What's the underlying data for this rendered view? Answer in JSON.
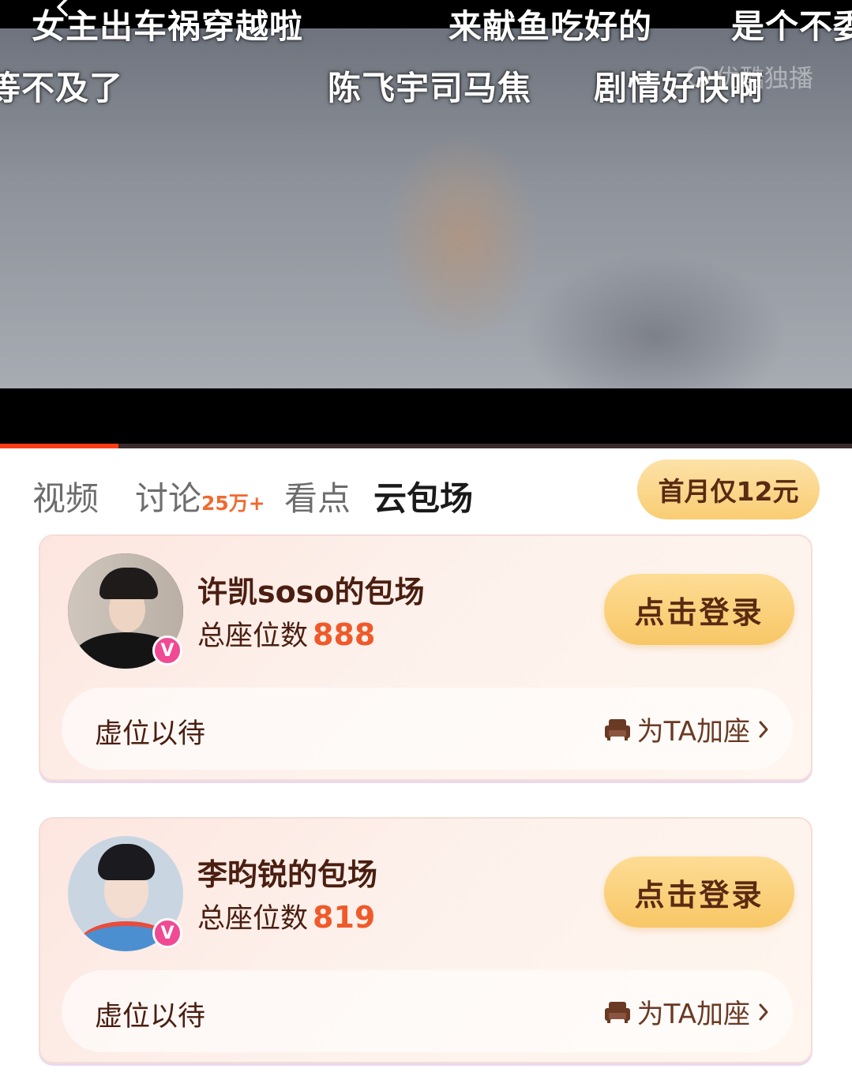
{
  "video": {
    "watermark": "优酷独播",
    "danmaku": [
      {
        "text": "女主出车祸穿越啦"
      },
      {
        "text": "来献鱼吃好的"
      },
      {
        "text": "是个不委"
      },
      {
        "text": "等不及了"
      },
      {
        "text": "陈飞宇司马焦"
      },
      {
        "text": "剧情好快啊"
      }
    ],
    "progress": 0.139
  },
  "tabs": {
    "items": [
      {
        "label": "视频"
      },
      {
        "label": "讨论",
        "badge": "25万+"
      },
      {
        "label": "看点"
      },
      {
        "label": "云包场",
        "active": true
      }
    ],
    "promo": "首月仅12元"
  },
  "cards": [
    {
      "title": "许凯soso的包场",
      "seats_label": "总座位数",
      "seats": "888",
      "login": "点击登录",
      "row_label": "虚位以待",
      "add_seat": "为TA加座"
    },
    {
      "title": "李昀锐的包场",
      "seats_label": "总座位数",
      "seats": "819",
      "login": "点击登录",
      "row_label": "虚位以待",
      "add_seat": "为TA加座"
    }
  ],
  "icons": {
    "back": "back-chevron-icon",
    "verified": "verified-v-icon",
    "sofa": "sofa-seat-icon",
    "chevron": "chevron-right-icon",
    "watermark_logo": "youku-logo-icon"
  },
  "colors": {
    "accent_orange": "#ef5a2a",
    "progress": "#ff3c14",
    "button_gold": "#f8c766",
    "badge_pink": "#f04a94",
    "text_brown": "#4a1e10"
  }
}
